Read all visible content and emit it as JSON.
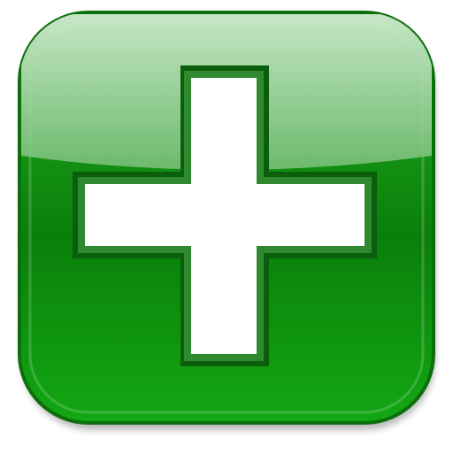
{
  "icon": {
    "kind": "add-button",
    "symbol": "plus-icon",
    "colors": {
      "base_dark": "#0a7f0a",
      "base_mid": "#13a713",
      "base_light": "#21b021",
      "rim": "#0c6f0c",
      "gloss_top": "#cfe9cf",
      "gloss_bottom": "#7ec17e",
      "cross_fill": "#ffffff",
      "cross_outline": "#2f8a2f",
      "cross_shadow": "#0b5e0b"
    }
  }
}
